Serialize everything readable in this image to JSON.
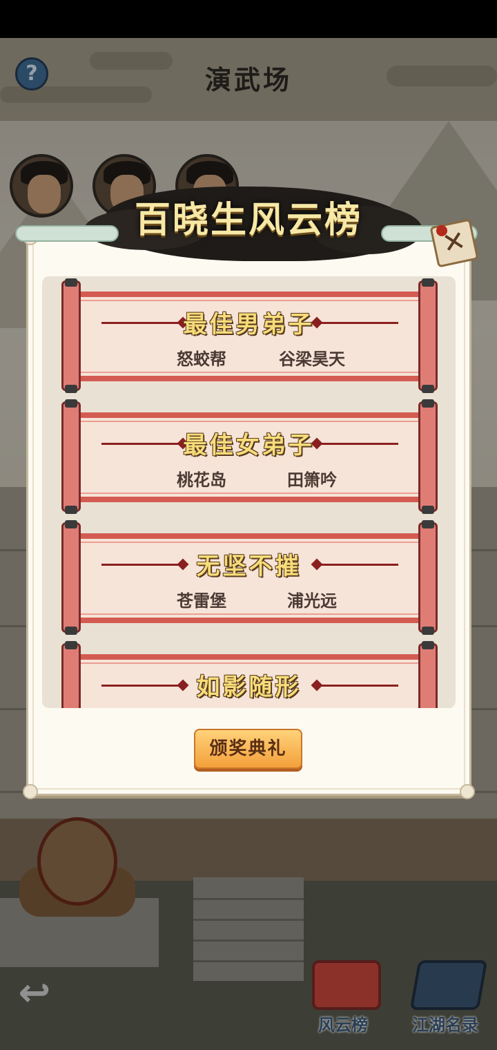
{
  "header": {
    "title": "演武场",
    "help_symbol": "?"
  },
  "dialog": {
    "banner_title": "百晓生风云榜",
    "close_symbol": "✕",
    "awards": [
      {
        "title": "最佳男弟子",
        "sect": "怒蛟帮",
        "name": "谷梁昊天"
      },
      {
        "title": "最佳女弟子",
        "sect": "桃花岛",
        "name": "田箫吟"
      },
      {
        "title": "无坚不摧",
        "sect": "苍雷堡",
        "name": "浦光远"
      },
      {
        "title": "如影随形",
        "sect": "",
        "name": ""
      }
    ],
    "ceremony_button": "颁奖典礼"
  },
  "bottom_nav": {
    "back_symbol": "↩",
    "items": [
      {
        "label": "风云榜",
        "icon": "scroll-ranking-icon"
      },
      {
        "label": "江湖名录",
        "icon": "book-roster-icon"
      }
    ]
  },
  "colors": {
    "scroll_red": "#d45b52",
    "gold_text": "#f6dd7a",
    "button_orange": "#f3a03a"
  }
}
